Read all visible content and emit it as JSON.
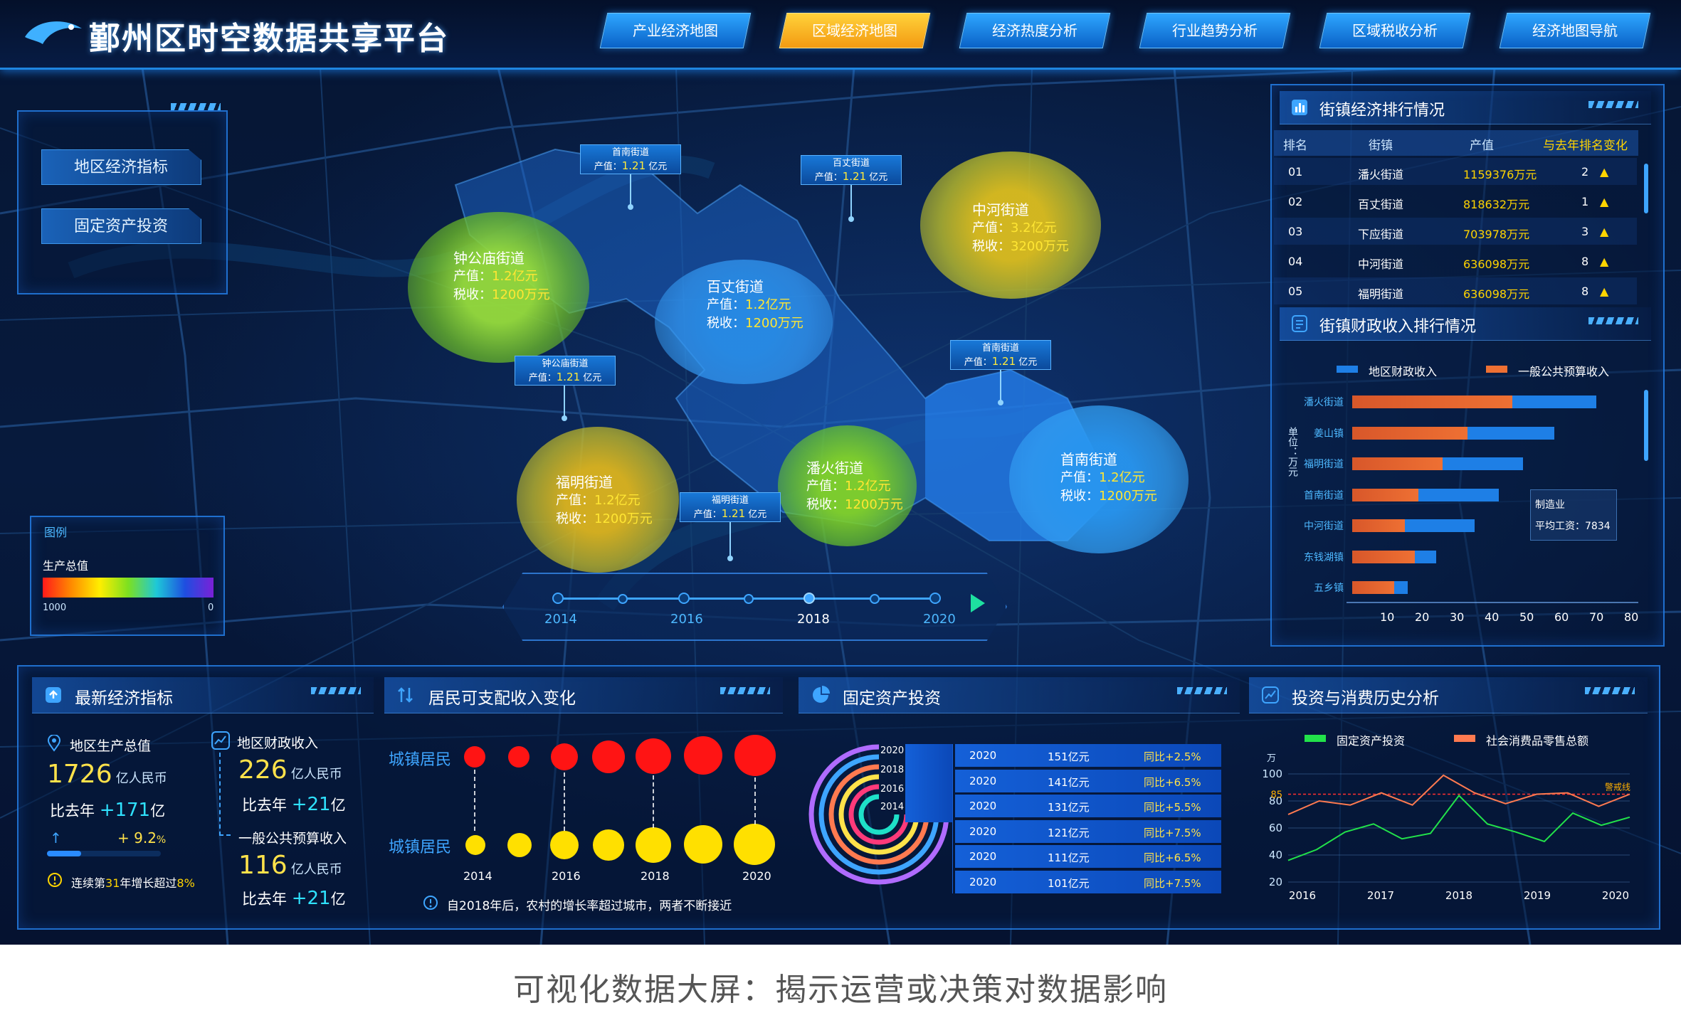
{
  "header": {
    "title": "鄞州区时空数据共享平台",
    "nav": [
      "产业经济地图",
      "区域经济地图",
      "经济热度分析",
      "行业趋势分析",
      "区域税收分析",
      "经济地图导航"
    ],
    "active_nav": 1
  },
  "indicator_box": {
    "items": [
      "地区经济指标",
      "固定资产投资"
    ]
  },
  "map": {
    "blobs": [
      {
        "name": "钟公庙街道",
        "output_label": "产值：",
        "output": "1.2亿元",
        "tax_label": "税收：",
        "tax": "1200万元",
        "color": "green"
      },
      {
        "name": "百丈街道",
        "output_label": "产值：",
        "output": "1.2亿元",
        "tax_label": "税收：",
        "tax": "1200万元",
        "color": "blue"
      },
      {
        "name": "中河街道",
        "output_label": "产值：",
        "output": "3.2亿元",
        "tax_label": "税收：",
        "tax": "3200万元",
        "color": "yellow"
      },
      {
        "name": "福明街道",
        "output_label": "产值：",
        "output": "1.2亿元",
        "tax_label": "税收：",
        "tax": "1200万元",
        "color": "yellow"
      },
      {
        "name": "潘火街道",
        "output_label": "产值：",
        "output": "1.2亿元",
        "tax_label": "税收：",
        "tax": "1200万元",
        "color": "green"
      },
      {
        "name": "首南街道",
        "output_label": "产值：",
        "output": "1.2亿元",
        "tax_label": "税收：",
        "tax": "1200万元",
        "color": "blue"
      }
    ],
    "tags": [
      {
        "name": "首南街道",
        "prefix": "产值：",
        "value": "1.21",
        "unit": "亿元"
      },
      {
        "name": "百丈街道",
        "prefix": "产值：",
        "value": "1.21",
        "unit": "亿元"
      },
      {
        "name": "钟公庙街道",
        "prefix": "产值：",
        "value": "1.21",
        "unit": "亿元"
      },
      {
        "name": "首南街道",
        "prefix": "产值：",
        "value": "1.21",
        "unit": "亿元"
      },
      {
        "name": "福明街道",
        "prefix": "产值：",
        "value": "1.21",
        "unit": "亿元"
      }
    ],
    "timeline": {
      "labels": [
        "2014",
        "2016",
        "2018",
        "2020"
      ],
      "current": "2018"
    },
    "legend": {
      "title": "图例",
      "subtitle": "生产总值",
      "min": "1000",
      "max": "0"
    }
  },
  "ranking": {
    "title": "街镇经济排行情况",
    "headers": [
      "排名",
      "街镇",
      "产值",
      "与去年排名变化"
    ],
    "rows": [
      {
        "rank": "01",
        "name": "潘火街道",
        "value": "1159376万元",
        "change": "2"
      },
      {
        "rank": "02",
        "name": "百丈街道",
        "value": "818632万元",
        "change": "1"
      },
      {
        "rank": "03",
        "name": "下应街道",
        "value": "703978万元",
        "change": "3"
      },
      {
        "rank": "04",
        "name": "中河街道",
        "value": "636098万元",
        "change": "8"
      },
      {
        "rank": "05",
        "name": "福明街道",
        "value": "636098万元",
        "change": "8"
      }
    ],
    "up_symbol": "▲"
  },
  "fiscal": {
    "title": "街镇财政收入排行情况",
    "unit_label": "单位：万元",
    "tooltip": {
      "industry": "制造业",
      "wage": "平均工资：7834"
    },
    "chart_data": {
      "type": "bar",
      "orientation": "horizontal",
      "categories": [
        "潘火街道",
        "姜山镇",
        "福明街道",
        "首南街道",
        "中河街道",
        "东钱湖镇",
        "五乡镇"
      ],
      "series": [
        {
          "name": "地区财政收入",
          "color": "#1e7fe6",
          "values": [
            70,
            58,
            49,
            42,
            35,
            24,
            16
          ]
        },
        {
          "name": "一般公共预算收入",
          "color": "#ee7033",
          "values": [
            46,
            33,
            26,
            19,
            15,
            18,
            12
          ]
        }
      ],
      "xticks": [
        "10",
        "20",
        "30",
        "40",
        "50",
        "60",
        "70",
        "80"
      ],
      "xlim": [
        0,
        80
      ]
    }
  },
  "econ": {
    "title": "最新经济指标",
    "gdp_label": "地区生产总值",
    "gdp_value": "1726",
    "gdp_unit": "亿人民币",
    "gdp_cmp_prefix": "比去年",
    "gdp_cmp_value": "+171",
    "gdp_cmp_unit": "亿",
    "growth_arrow": "↑",
    "growth_value": "+ 9.2",
    "growth_unit": "%",
    "growth_progress": 0.3,
    "note_prefix": "连续第",
    "note_num": "31",
    "note_mid": "年增长超过",
    "note_pct": "8%",
    "fiscal_label": "地区财政收入",
    "fiscal_value": "226",
    "fiscal_unit": "亿人民币",
    "fiscal_cmp_prefix": "比去年",
    "fiscal_cmp_value": "+21",
    "fiscal_cmp_unit": "亿",
    "budget_label": "一般公共预算收入",
    "budget_value": "116",
    "budget_unit": "亿人民币",
    "budget_cmp_prefix": "比去年",
    "budget_cmp_value": "+21",
    "budget_cmp_unit": "亿"
  },
  "income": {
    "title": "居民可支配收入变化",
    "row1_label": "城镇居民",
    "row2_label": "城镇居民",
    "years": [
      "2014",
      "2016",
      "2018",
      "2020"
    ],
    "note": "自2018年后，农村的增长率超过城市，两者不断接近"
  },
  "fixed": {
    "title": "固定资产投资",
    "ring_years": [
      "2020",
      "2018",
      "2016",
      "2014"
    ],
    "rows": [
      {
        "year": "2020",
        "value": "151亿元",
        "yoy": "同比+2.5%"
      },
      {
        "year": "2020",
        "value": "141亿元",
        "yoy": "同比+6.5%"
      },
      {
        "year": "2020",
        "value": "131亿元",
        "yoy": "同比+5.5%"
      },
      {
        "year": "2020",
        "value": "121亿元",
        "yoy": "同比+7.5%"
      },
      {
        "year": "2020",
        "value": "111亿元",
        "yoy": "同比+6.5%"
      },
      {
        "year": "2020",
        "value": "101亿元",
        "yoy": "同比+7.5%"
      }
    ]
  },
  "history": {
    "title": "投资与消费历史分析",
    "unit": "万",
    "warning_label": "警戒线",
    "chart_data": {
      "type": "line",
      "x": [
        2015.5,
        2016,
        2016.5,
        2017,
        2017.5,
        2018,
        2018.5,
        2019,
        2019.5,
        2020
      ],
      "xticks": [
        "2016",
        "2017",
        "2018",
        "2019",
        "2020"
      ],
      "yticks": [
        "100",
        "80",
        "60",
        "40",
        "20"
      ],
      "ylim": [
        20,
        100
      ],
      "warning_value": 85,
      "series": [
        {
          "name": "固定资产投资",
          "color": "#22e24a",
          "values": [
            36,
            44,
            57,
            63,
            52,
            56,
            84,
            63,
            57,
            50,
            71,
            62,
            68
          ]
        },
        {
          "name": "社会消费品零售总额",
          "color": "#ff7a50",
          "values": [
            70,
            80,
            77,
            86,
            77,
            99,
            86,
            78,
            85,
            86,
            76,
            85
          ]
        }
      ]
    }
  },
  "caption": "可视化数据大屏：揭示运营或决策对数据影响"
}
